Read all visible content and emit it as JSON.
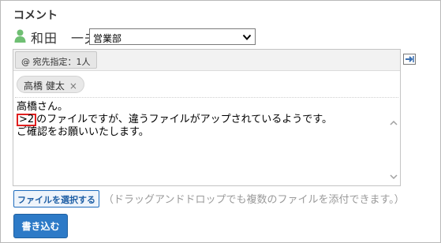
{
  "section": {
    "title": "コメント"
  },
  "author": {
    "name": "和田　一夫"
  },
  "department_select": {
    "selected": "営業部"
  },
  "editor": {
    "recipients_button": "@ 宛先指定：1人",
    "recipient_chip": {
      "name": "高橋 健太",
      "remove": "×"
    },
    "body": {
      "line1": "高橋さん。",
      "reply_mark": ">2",
      "line2_rest": "のファイルですが、違うファイルがアップされているようです。",
      "line3": "ご確認をお願いいたします。"
    }
  },
  "file": {
    "button_label": "ファイルを選択する",
    "hint": "（ドラッグアンドドロップでも複数のファイルを添付できます。）"
  },
  "submit": {
    "label": "書き込む"
  },
  "colors": {
    "primary": "#2d7ac7",
    "link": "#1f5fa5",
    "highlight": "#e0201f",
    "user_icon": "#6fbf73"
  },
  "icons": {
    "user": "user-icon",
    "select_arrow": "chevron-down-icon",
    "expand": "expand-icon",
    "scroll_up": "scroll-up-icon",
    "scroll_down": "scroll-down-icon"
  }
}
